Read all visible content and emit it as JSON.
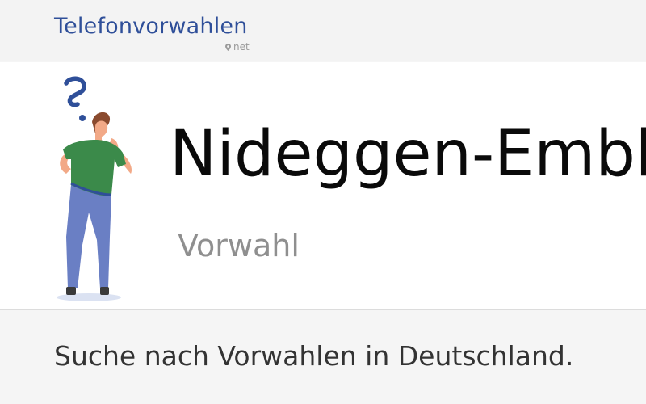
{
  "header": {
    "brand_name": "Telefonvorwahlen",
    "brand_tld": "net",
    "pin_icon": "map-pin-icon"
  },
  "hero": {
    "illustration": "thinking-person-question-mark-illustration",
    "title": "Nideggen-Embken",
    "subtitle": "Vorwahl"
  },
  "search": {
    "heading": "Suche nach Vorwahlen in Deutschland."
  },
  "colors": {
    "brand": "#2f4f99",
    "title": "#0a0a0a",
    "subtitle": "#8f8f8f",
    "shirt": "#3b8a4a",
    "pants": "#6a7fc4"
  }
}
